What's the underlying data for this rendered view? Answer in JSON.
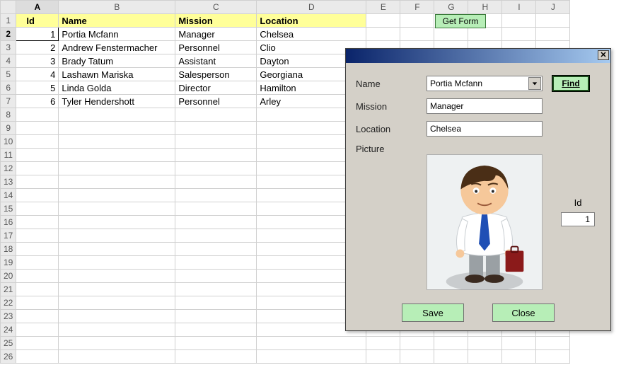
{
  "columns": [
    "A",
    "B",
    "C",
    "D",
    "E",
    "F",
    "G",
    "H",
    "I",
    "J"
  ],
  "headers": {
    "id": "Id",
    "name": "Name",
    "mission": "Mission",
    "location": "Location"
  },
  "rows": [
    {
      "id": "1",
      "name": "Portia Mcfann",
      "mission": "Manager",
      "location": "Chelsea"
    },
    {
      "id": "2",
      "name": "Andrew Fenstermacher",
      "mission": "Personnel",
      "location": "Clio"
    },
    {
      "id": "3",
      "name": "Brady Tatum",
      "mission": "Assistant",
      "location": "Dayton"
    },
    {
      "id": "4",
      "name": "Lashawn Mariska",
      "mission": "Salesperson",
      "location": "Georgiana"
    },
    {
      "id": "5",
      "name": "Linda Golda",
      "mission": "Director",
      "location": "Hamilton"
    },
    {
      "id": "6",
      "name": "Tyler Hendershott",
      "mission": "Personnel",
      "location": "Arley"
    }
  ],
  "total_rows": 26,
  "selected_row": 2,
  "button": {
    "get_form": "Get Form"
  },
  "dialog": {
    "labels": {
      "name": "Name",
      "mission": "Mission",
      "location": "Location",
      "picture": "Picture",
      "id": "Id"
    },
    "fields": {
      "name": "Portia Mcfann",
      "mission": "Manager",
      "location": "Chelsea",
      "id": "1"
    },
    "buttons": {
      "find": "Find",
      "save": "Save",
      "close": "Close"
    }
  }
}
